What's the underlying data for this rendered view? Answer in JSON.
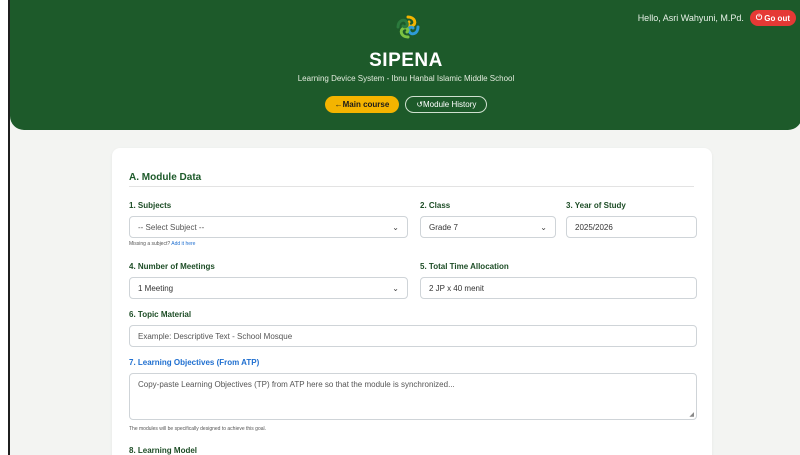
{
  "header": {
    "greeting": "Hello, Asri Wahyuni, M.Pd.",
    "logout_label": "Go out",
    "title": "SIPENA",
    "subtitle": "Learning Device System - Ibnu Hanbal Islamic Middle School",
    "main_course_label": "Main course",
    "module_history_label": "Module History"
  },
  "form": {
    "section_title": "A. Module Data",
    "subjects": {
      "label": "1. Subjects",
      "value": "-- Select Subject --"
    },
    "missing_hint": "Missing a subject?",
    "add_link": "Add it here",
    "class": {
      "label": "2. Class",
      "value": "Grade 7"
    },
    "year": {
      "label": "3. Year of Study",
      "value": "2025/2026"
    },
    "meetings": {
      "label": "4. Number of Meetings",
      "value": "1 Meeting"
    },
    "time_allocation": {
      "label": "5. Total Time Allocation",
      "value": "2 JP x 40 menit"
    },
    "topic": {
      "label": "6. Topic Material",
      "placeholder": "Example: Descriptive Text - School Mosque"
    },
    "objectives": {
      "label": "7. Learning Objectives (From ATP)",
      "placeholder": "Copy-paste Learning Objectives (TP) from ATP here so that the module is synchronized...",
      "hint": "The modules will be specifically designed to achieve this goal."
    },
    "learning_model": {
      "label": "8. Learning Model"
    }
  },
  "colors": {
    "header_green": "#1d5a2a",
    "accent_yellow": "#f4b400",
    "logout_red": "#e53935",
    "link_blue": "#1f6fd0"
  }
}
